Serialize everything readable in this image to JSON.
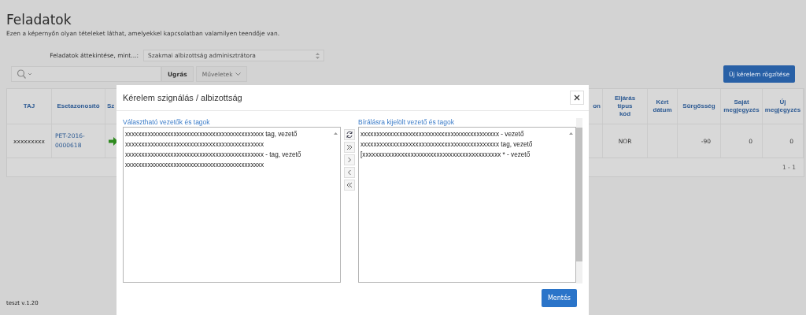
{
  "page": {
    "title": "Feladatok",
    "subtitle": "Ezen a képernyőn olyan tételeket láthat, amelyekkel kapcsolatban valamilyen teendője van."
  },
  "filter": {
    "label": "Feladatok áttekintése, mint...:",
    "value": "Szakmai albizottság adminisztrátora"
  },
  "toolbar": {
    "go": "Ugrás",
    "actions": "Műveletek",
    "new": "Új kérelem rögzítése"
  },
  "table": {
    "columns": [
      "TAJ",
      "Esetazonosító",
      "Sz",
      "on",
      "Eljárás típus kód",
      "Kért dátum",
      "Sürgősség",
      "Saját megjegyzés",
      "Új megjegyzés"
    ],
    "rows": [
      {
        "cells": [
          {
            "kind": "text",
            "text": "xxxxxxxxx"
          },
          {
            "kind": "link",
            "text": "PET-2016-0000618"
          },
          {
            "kind": "arrow"
          },
          {
            "kind": "empty"
          },
          {
            "kind": "text",
            "text": "NOR"
          },
          {
            "kind": "empty"
          },
          {
            "kind": "number",
            "text": "-90"
          },
          {
            "kind": "number",
            "text": "0"
          },
          {
            "kind": "number",
            "text": "0"
          }
        ]
      }
    ],
    "pagination": "1 - 1"
  },
  "footer": "teszt v.1.20",
  "dialog": {
    "title": "Kérelem szignálás / albizottság",
    "available": {
      "label": "Választható vezetők és tagok",
      "items": [
        "xxxxxxxxxxxxxxxxxxxxxxxxxxxxxxxxxxxxxxxxxxx tag, vezető",
        "xxxxxxxxxxxxxxxxxxxxxxxxxxxxxxxxxxxxxxxxxxx",
        "xxxxxxxxxxxxxxxxxxxxxxxxxxxxxxxxxxxxxxxxxxx  - tag, vezető",
        "xxxxxxxxxxxxxxxxxxxxxxxxxxxxxxxxxxxxxxxxxxx"
      ]
    },
    "selected": {
      "label": "Bírálásra kijelölt vezető és tagok",
      "items": [
        "xxxxxxxxxxxxxxxxxxxxxxxxxxxxxxxxxxxxxxxxxxx  - vezető",
        "xxxxxxxxxxxxxxxxxxxxxxxxxxxxxxxxxxxxxxxxxxx tag, vezető",
        "[xxxxxxxxxxxxxxxxxxxxxxxxxxxxxxxxxxxxxxxxxxx * - vezető"
      ]
    },
    "save": "Mentés"
  }
}
